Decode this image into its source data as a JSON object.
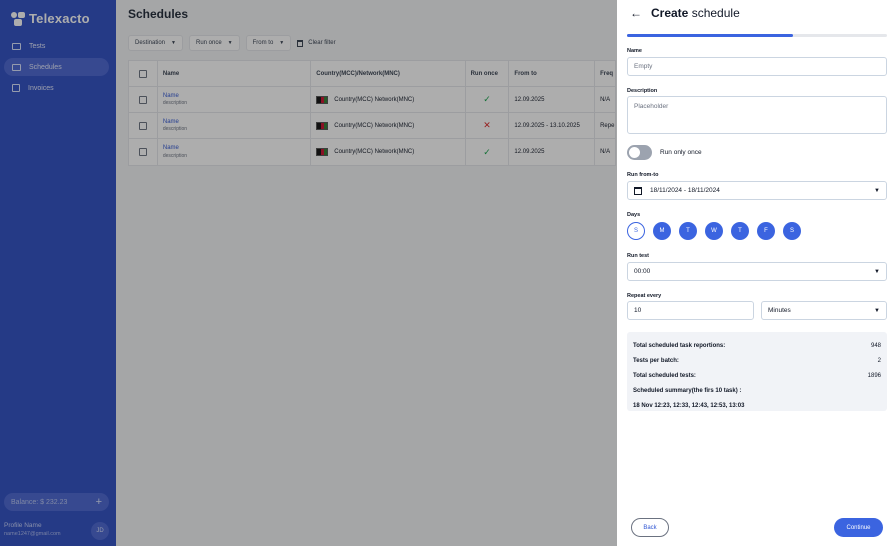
{
  "app": {
    "brand": "Telexacto"
  },
  "sidebar": {
    "items": [
      {
        "label": "Tests",
        "icon": "tests-icon"
      },
      {
        "label": "Schedules",
        "icon": "calendar-icon",
        "active": true
      },
      {
        "label": "Invoices",
        "icon": "invoice-icon"
      }
    ],
    "balance": "Balance: $ 232.23",
    "profile_name": "Profile Name",
    "profile_email": "name1247@gmail.com",
    "avatar_initials": "JD"
  },
  "main": {
    "title": "Schedules",
    "filters": [
      {
        "label": "Destination"
      },
      {
        "label": "Run once"
      },
      {
        "label": "From to"
      }
    ],
    "clear_filter": "Clear filter",
    "columns": [
      "Name",
      "Country(MCC)/Network(MNC)",
      "Run once",
      "From to",
      "Freq"
    ],
    "rows": [
      {
        "name": "Name",
        "desc": "description",
        "country": "Country(MCC) Network(MNC)",
        "run_once": true,
        "from_to": "12.09.2025",
        "freq": "N/A"
      },
      {
        "name": "Name",
        "desc": "description",
        "country": "Country(MCC) Network(MNC)",
        "run_once": false,
        "from_to": "12.09.2025 - 13.10.2025",
        "freq": "Repe"
      },
      {
        "name": "Name",
        "desc": "description",
        "country": "Country(MCC) Network(MNC)",
        "run_once": true,
        "from_to": "12.09.2025",
        "freq": "N/A"
      }
    ]
  },
  "panel": {
    "title_bold": "Create",
    "title_rest": "schedule",
    "progress": 0.64,
    "name_label": "Name",
    "name_placeholder": "Empty",
    "description_label": "Description",
    "description_placeholder": "Placeholder",
    "run_once_label": "Run only once",
    "run_from_to_label": "Run from-to",
    "run_from_to_value": "18/11/2024 - 18/11/2024",
    "days_label": "Days",
    "days": [
      {
        "label": "S",
        "selected": false
      },
      {
        "label": "M",
        "selected": true
      },
      {
        "label": "T",
        "selected": true
      },
      {
        "label": "W",
        "selected": true
      },
      {
        "label": "T",
        "selected": true
      },
      {
        "label": "F",
        "selected": true
      },
      {
        "label": "S",
        "selected": true
      }
    ],
    "run_test_label": "Run test",
    "run_test_value": "00:00",
    "repeat_label": "Repeat every",
    "repeat_value": "10",
    "repeat_unit": "Minutes",
    "summary": {
      "total_reportions_label": "Total scheduled task reportions:",
      "total_reportions_value": "948",
      "tests_per_batch_label": "Tests per batch:",
      "tests_per_batch_value": "2",
      "total_tests_label": "Total scheduled tests:",
      "total_tests_value": "1896",
      "summary_title": "Scheduled summary(the firs 10 task) :",
      "summary_times": "18 Nov 12:23, 12:33, 12:43, 12:53, 13:03"
    },
    "back_label": "Back",
    "continue_label": "Continue"
  },
  "colors": {
    "sidebar": "#2f4fc4",
    "accent": "#3b64e0",
    "check": "#16a34a",
    "cross": "#dc2626"
  }
}
